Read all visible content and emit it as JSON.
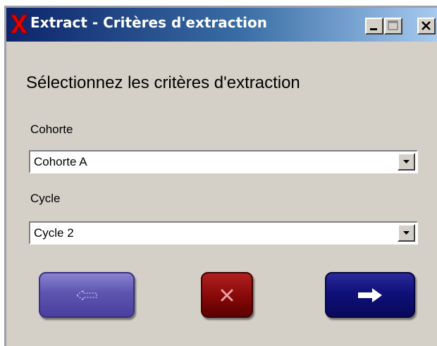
{
  "window": {
    "title": "Extract - Critères d'extraction",
    "icon": "x-app-icon",
    "controls": {
      "minimize_icon": "minimize-icon",
      "maximize_icon": "maximize-icon",
      "close_icon": "close-icon"
    }
  },
  "form": {
    "heading": "Sélectionnez les critères d'extraction",
    "cohorte": {
      "label": "Cohorte",
      "selected": "Cohorte A"
    },
    "cycle": {
      "label": "Cycle",
      "selected": "Cycle 2"
    }
  },
  "buttons": {
    "back": {
      "icon": "arrow-left-icon",
      "enabled": false
    },
    "cancel": {
      "icon": "x-icon"
    },
    "next": {
      "icon": "arrow-right-icon",
      "enabled": true
    }
  },
  "colors": {
    "window_bg": "#d4d0c8",
    "titlebar_start": "#0c246a",
    "titlebar_end": "#a6caf0",
    "back_button": "#5c55b0",
    "cancel_button": "#8a0a0a",
    "next_button": "#10107a",
    "app_icon_red": "#e00000"
  }
}
